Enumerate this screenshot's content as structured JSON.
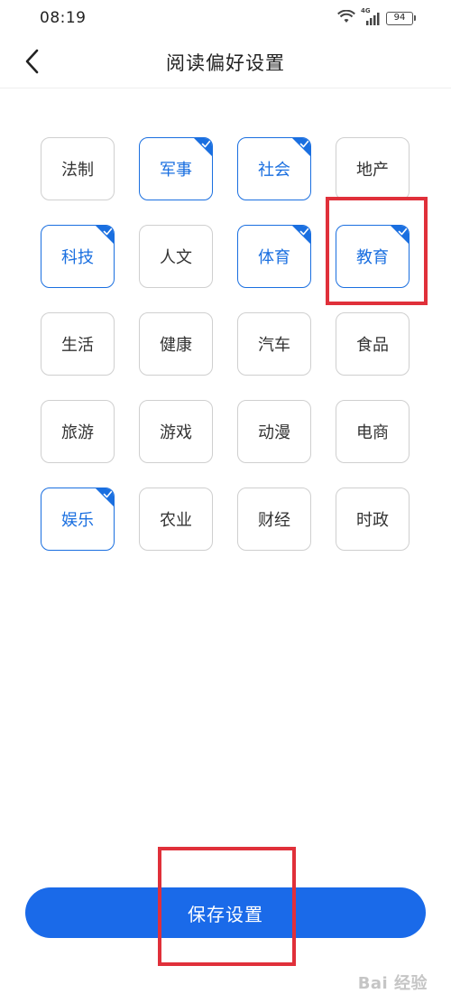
{
  "status_bar": {
    "time": "08:19",
    "network": "4G",
    "battery": "94"
  },
  "header": {
    "title": "阅读偏好设置",
    "back_icon": "chevron-left-icon"
  },
  "colors": {
    "accent": "#1a6fe0",
    "button": "#1a6ae9",
    "highlight": "#e0303a"
  },
  "tags": [
    {
      "label": "法制",
      "selected": false
    },
    {
      "label": "军事",
      "selected": true
    },
    {
      "label": "社会",
      "selected": true
    },
    {
      "label": "地产",
      "selected": false
    },
    {
      "label": "科技",
      "selected": true
    },
    {
      "label": "人文",
      "selected": false
    },
    {
      "label": "体育",
      "selected": true
    },
    {
      "label": "教育",
      "selected": true
    },
    {
      "label": "生活",
      "selected": false
    },
    {
      "label": "健康",
      "selected": false
    },
    {
      "label": "汽车",
      "selected": false
    },
    {
      "label": "食品",
      "selected": false
    },
    {
      "label": "旅游",
      "selected": false
    },
    {
      "label": "游戏",
      "selected": false
    },
    {
      "label": "动漫",
      "selected": false
    },
    {
      "label": "电商",
      "selected": false
    },
    {
      "label": "娱乐",
      "selected": true
    },
    {
      "label": "农业",
      "selected": false
    },
    {
      "label": "财经",
      "selected": false
    },
    {
      "label": "时政",
      "selected": false
    }
  ],
  "save_button": {
    "label": "保存设置"
  },
  "watermark": "Bai 经验"
}
